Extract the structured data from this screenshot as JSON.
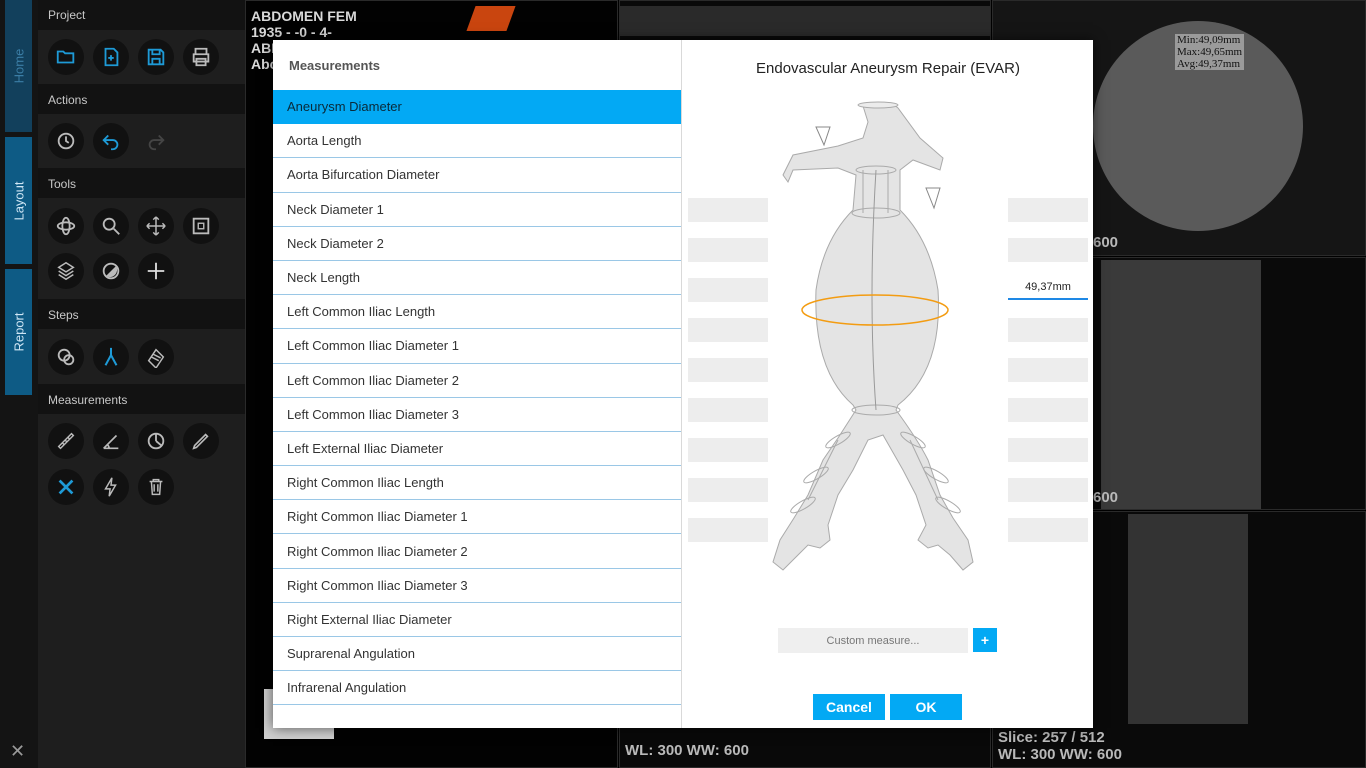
{
  "sidebar_tabs": [
    {
      "label": "Home"
    },
    {
      "label": "Layout"
    },
    {
      "label": "Report"
    }
  ],
  "toolbar": {
    "sections": {
      "project": "Project",
      "actions": "Actions",
      "tools": "Tools",
      "steps": "Steps",
      "measurements": "Measurements"
    }
  },
  "viewers": {
    "top_left": {
      "line1": "ABDOMEN FEM",
      "line2": "1935 - -0 - 4-",
      "line3": "ABI",
      "line4": "Abc"
    },
    "top_right": {
      "stat_min": "Min:49,09mm",
      "stat_max": "Max:49,65mm",
      "stat_avg": "Avg:49,37mm",
      "corner_num": "600"
    },
    "middle_right": {
      "corner_num": "600"
    },
    "bottom_mid": {
      "wlww": "WL: 300   WW: 600"
    },
    "bottom_right": {
      "slice": "Slice: 257 / 512",
      "wlww": "WL: 300   WW: 600"
    }
  },
  "dialog": {
    "measurements_title": "Measurements",
    "diagram_title": "Endovascular Aneurysm Repair (EVAR)",
    "items": [
      {
        "label": "Aneurysm Diameter"
      },
      {
        "label": "Aorta Length"
      },
      {
        "label": "Aorta Bifurcation Diameter"
      },
      {
        "label": "Neck Diameter 1"
      },
      {
        "label": "Neck Diameter 2"
      },
      {
        "label": "Neck Length"
      },
      {
        "label": "Left Common Iliac Length"
      },
      {
        "label": "Left Common Iliac Diameter 1"
      },
      {
        "label": "Left Common Iliac Diameter 2"
      },
      {
        "label": "Left Common Iliac Diameter 3"
      },
      {
        "label": "Left External Iliac Diameter"
      },
      {
        "label": "Right Common Iliac Length"
      },
      {
        "label": "Right Common Iliac Diameter 1"
      },
      {
        "label": "Right Common Iliac Diameter 2"
      },
      {
        "label": "Right Common Iliac Diameter 3"
      },
      {
        "label": "Right External Iliac Diameter"
      },
      {
        "label": "Suprarenal Angulation"
      },
      {
        "label": "Infrarenal Angulation"
      }
    ],
    "measured_value": "49,37mm",
    "custom_placeholder": "Custom measure...",
    "add_label": "+",
    "cancel_label": "Cancel",
    "ok_label": "OK"
  },
  "colors": {
    "accent": "#03a9f4",
    "tab_blue": "#0a6da3",
    "selection_ring": "#f39c12"
  }
}
